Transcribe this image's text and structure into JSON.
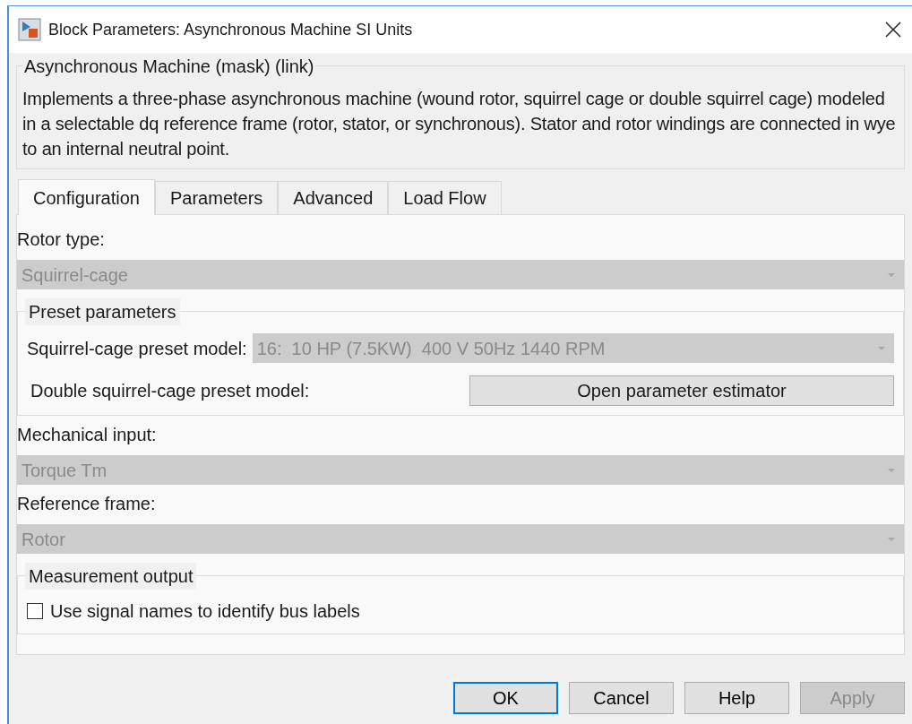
{
  "window": {
    "title": "Block Parameters: Asynchronous Machine SI Units"
  },
  "mask": {
    "title": "Asynchronous Machine (mask) (link)",
    "description": "Implements a three-phase asynchronous machine (wound rotor, squirrel cage or double squirrel cage) modeled in a selectable dq reference frame (rotor, stator, or synchronous). Stator and rotor windings are connected in wye to an internal neutral point."
  },
  "tabs": [
    {
      "label": "Configuration",
      "selected": true
    },
    {
      "label": "Parameters",
      "selected": false
    },
    {
      "label": "Advanced",
      "selected": false
    },
    {
      "label": "Load Flow",
      "selected": false
    }
  ],
  "sections": [
    {
      "kind": "dropdown",
      "label": "Rotor type:",
      "value": "Squirrel-cage",
      "disabled": true
    },
    {
      "kind": "group",
      "title": "Preset parameters",
      "rows": [
        {
          "kind": "dropdown",
          "label": "Squirrel-cage preset model:",
          "value": "16:  10 HP (7.5KW)  400 V 50Hz 1440 RPM",
          "disabled": true
        },
        {
          "kind": "button",
          "label": "Double squirrel-cage preset model:",
          "button": "Open parameter estimator"
        }
      ]
    },
    {
      "kind": "dropdown",
      "label": "Mechanical input:",
      "value": "Torque Tm",
      "disabled": true
    },
    {
      "kind": "dropdown",
      "label": "Reference frame:",
      "value": "Rotor",
      "disabled": true
    },
    {
      "kind": "group",
      "title": "Measurement output",
      "rows": [
        {
          "kind": "checkbox",
          "label": "Use signal names to identify bus labels",
          "checked": false
        }
      ]
    }
  ],
  "buttons": [
    {
      "label": "OK",
      "default": true,
      "disabled": false
    },
    {
      "label": "Cancel",
      "default": false,
      "disabled": false
    },
    {
      "label": "Help",
      "default": false,
      "disabled": false
    },
    {
      "label": "Apply",
      "default": false,
      "disabled": true
    }
  ]
}
